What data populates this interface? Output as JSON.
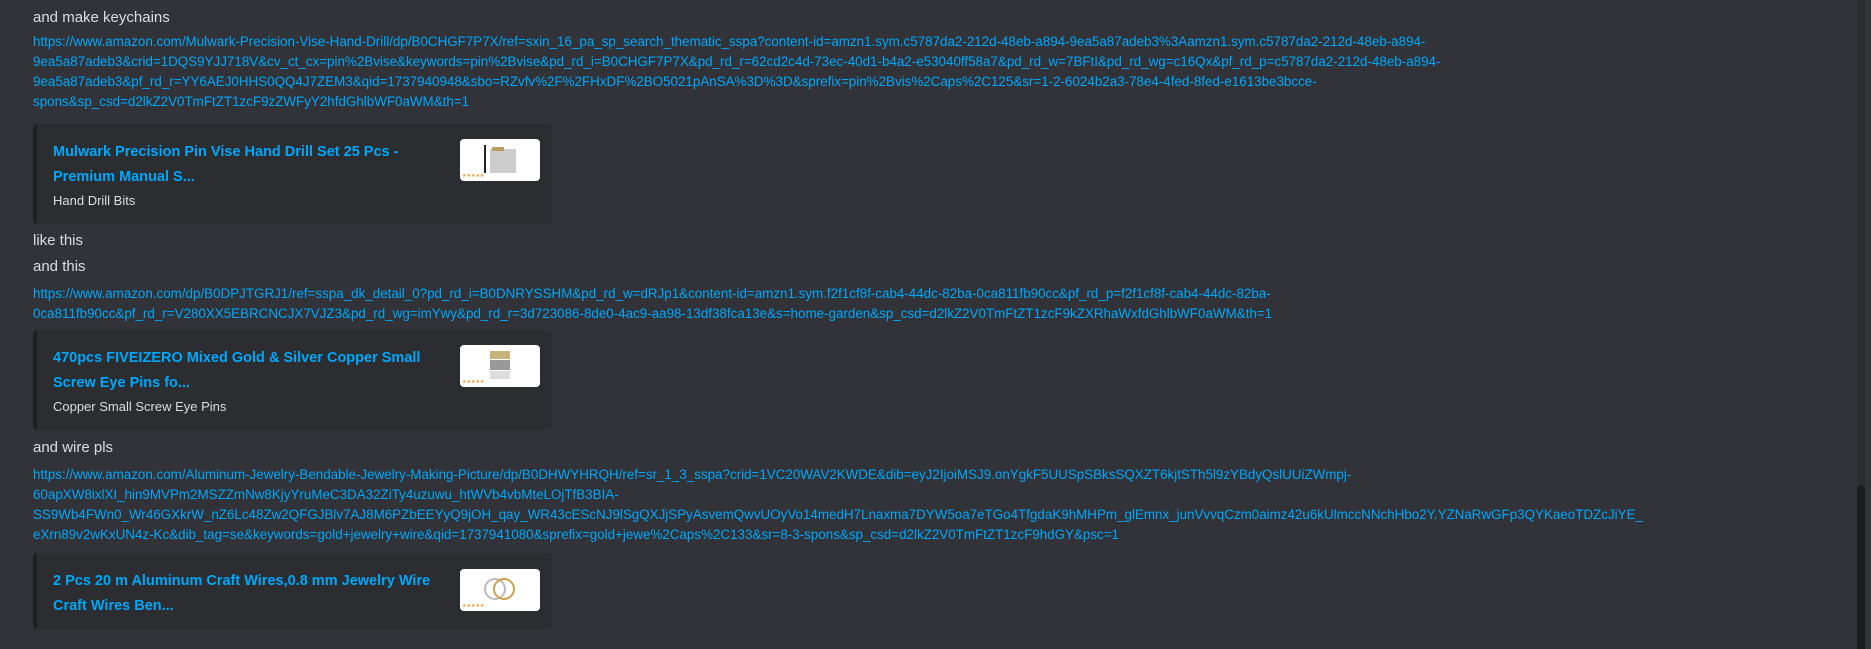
{
  "messages": [
    {
      "text": "and make keychains"
    },
    {
      "url_lines": [
        "https://www.amazon.com/Mulwark-Precision-Vise-Hand-Drill/dp/B0CHGF7P7X/ref=sxin_16_pa_sp_search_thematic_sspa?content-id=amzn1.sym.c5787da2-212d-48eb-a894-9ea5a87adeb3%3Aamzn1.sym.c5787da2-212d-48eb-a894-",
        "9ea5a87adeb3&crid=1DQS9YJJ718V&cv_ct_cx=pin%2Bvise&keywords=pin%2Bvise&pd_rd_i=B0CHGF7P7X&pd_rd_r=62cd2c4d-73ec-40d1-b4a2-e53040ff58a7&pd_rd_w=7BFtI&pd_rd_wg=c16Qx&pf_rd_p=c5787da2-212d-48eb-a894-",
        "9ea5a87adeb3&pf_rd_r=YY6AEJ0HHS0QQ4J7ZEM3&qid=1737940948&sbo=RZvfv%2F%2FHxDF%2BO5021pAnSA%3D%3D&sprefix=pin%2Bvis%2Caps%2C125&sr=1-2-6024b2a3-78e4-4fed-8fed-e1613be3bcce-",
        "spons&sp_csd=d2lkZ2V0TmFtZT1zcF9zZWFyY2hfdGhlbWF0aWM&th=1"
      ]
    },
    {
      "embed": {
        "title_lines": [
          "Mulwark Precision Pin Vise Hand Drill Set 25 Pcs -",
          "Premium Manual S..."
        ],
        "description": "Hand Drill Bits",
        "thumbnail": "drill-set-image"
      }
    },
    {
      "text": "like this"
    },
    {
      "text": "and this"
    },
    {
      "url_lines": [
        "https://www.amazon.com/dp/B0DPJTGRJ1/ref=sspa_dk_detail_0?pd_rd_i=B0DNRYSSHM&pd_rd_w=dRJp1&content-id=amzn1.sym.f2f1cf8f-cab4-44dc-82ba-0ca811fb90cc&pf_rd_p=f2f1cf8f-cab4-44dc-82ba-",
        "0ca811fb90cc&pf_rd_r=V280XX5EBRCNCJX7VJZ3&pd_rd_wg=imYwy&pd_rd_r=3d723086-8de0-4ac9-aa98-13df38fca13e&s=home-garden&sp_csd=d2lkZ2V0TmFtZT1zcF9kZXRhaWxfdGhlbWF0aWM&th=1"
      ]
    },
    {
      "embed": {
        "title_lines": [
          "470pcs FIVEIZERO Mixed Gold & Silver Copper Small",
          "Screw Eye Pins fo..."
        ],
        "description": "Copper Small Screw Eye Pins",
        "thumbnail": "eye-pins-image"
      }
    },
    {
      "text": "and wire pls"
    },
    {
      "url_lines": [
        "https://www.amazon.com/Aluminum-Jewelry-Bendable-Jewelry-Making-Picture/dp/B0DHWYHRQH/ref=sr_1_3_sspa?crid=1VC20WAV2KWDE&dib=eyJ2IjoiMSJ9.onYgkF5UUSpSBksSQXZT6kjtSTh5l9zYBdyQslUUiZWmpj-",
        "60apXW8ixlXI_hin9MVPm2MSZZmNw8KjyYruMeC3DA32ZiTy4uzuwu_htWVb4vbMteLOjTfB3BIA-",
        "SS9Wb4FWn0_Wr46GXkrW_nZ6Lc48Zw2QFGJBlv7AJ8M6PZbEEYyQ9jOH_qay_WR43cEScNJ9lSgQXJjSPyAsvemQwvUOyVo14medH7Lnaxma7DYW5oa7eTGo4TfgdaK9hMHPm_glEmnx_junVvvqCzm0aimz42u6kUlmccNNchHbo2Y.YZNaRwGFp3QYKaeoTDZcJiYE_",
        "eXrn89v2wKxUN4z-Kc&dib_tag=se&keywords=gold+jewelry+wire&qid=1737941080&sprefix=gold+jewe%2Caps%2C133&sr=8-3-spons&sp_csd=d2lkZ2V0TmFtZT1zcF9hdGY&psc=1"
      ]
    },
    {
      "embed": {
        "title_lines": [
          "2 Pcs 20 m Aluminum Craft Wires,0.8 mm Jewelry Wire",
          "Craft Wires Ben..."
        ],
        "thumbnail": "wire-rings-image"
      }
    }
  ],
  "colors": {
    "background": "#313338",
    "embed": "#2b2d31",
    "link": "#00a8fc",
    "text": "#dbdee1"
  }
}
